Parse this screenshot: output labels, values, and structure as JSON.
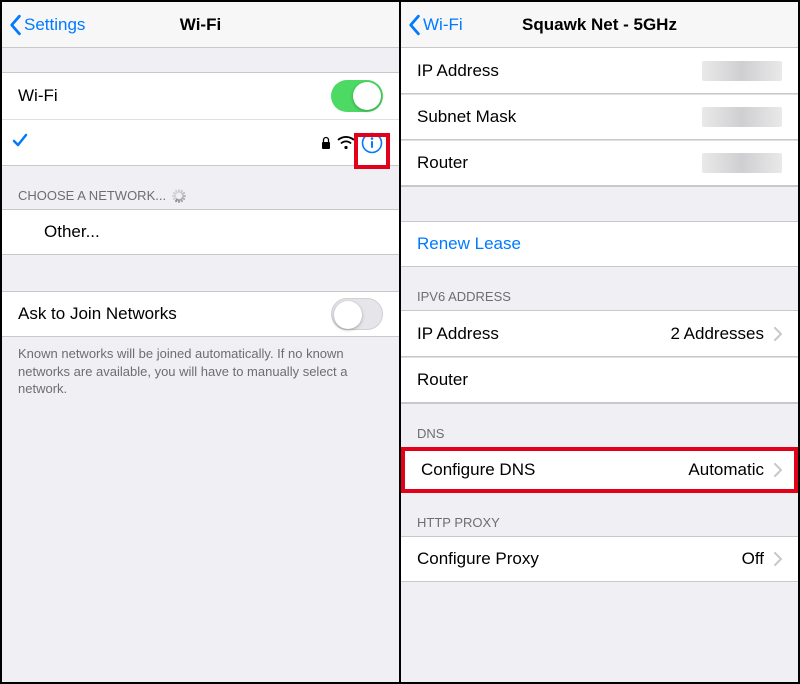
{
  "left": {
    "back": "Settings",
    "title": "Wi-Fi",
    "wifi_toggle_label": "Wi-Fi",
    "choose_header": "CHOOSE A NETWORK...",
    "other_label": "Other...",
    "ask_label": "Ask to Join Networks",
    "ask_footer": "Known networks will be joined automatically. If no known networks are available, you will have to manually select a network."
  },
  "right": {
    "back": "Wi-Fi",
    "title": "Squawk Net - 5GHz",
    "ip_address_label": "IP Address",
    "subnet_label": "Subnet Mask",
    "router_label": "Router",
    "renew_label": "Renew Lease",
    "ipv6_header": "IPV6 ADDRESS",
    "ipv6_ip_label": "IP Address",
    "ipv6_ip_value": "2 Addresses",
    "ipv6_router_label": "Router",
    "dns_header": "DNS",
    "dns_label": "Configure DNS",
    "dns_value": "Automatic",
    "proxy_header": "HTTP PROXY",
    "proxy_label": "Configure Proxy",
    "proxy_value": "Off"
  }
}
